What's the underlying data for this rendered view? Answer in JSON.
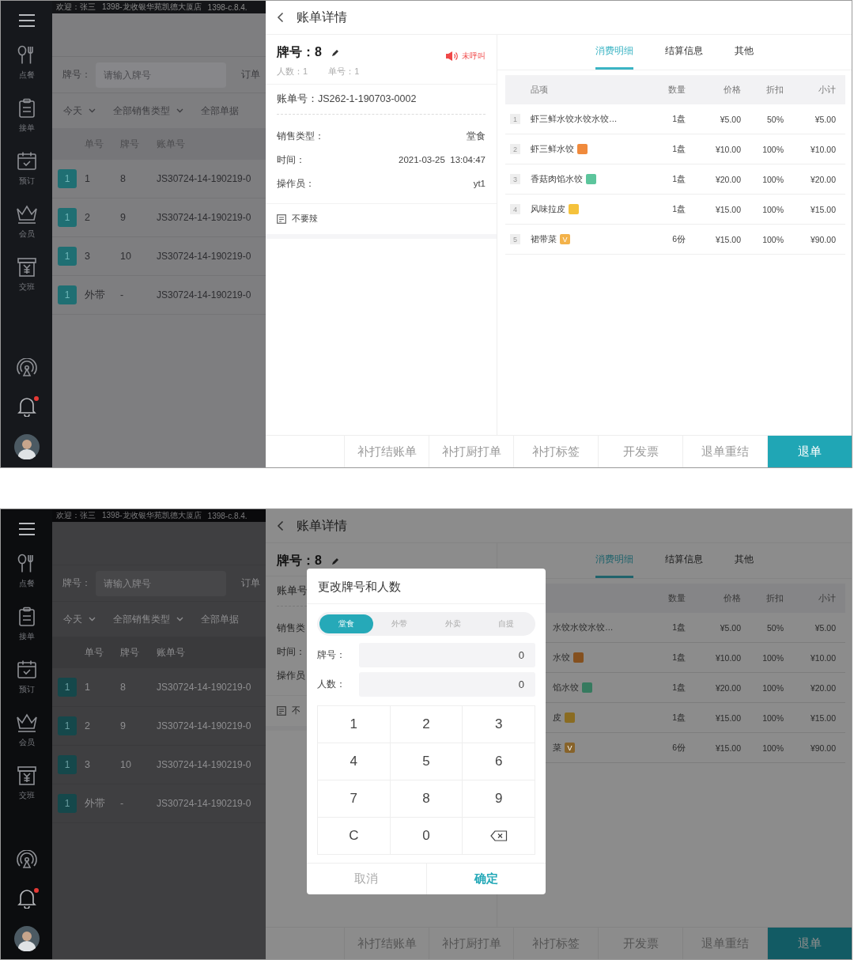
{
  "screens": [
    {
      "topbar": {
        "welcome": "欢迎：张三",
        "store": "1398-龙收银华苑凯德大厦店",
        "version": "1398-c.8.4."
      },
      "sidebar": {
        "items": [
          {
            "kind": "menu"
          },
          {
            "kind": "dine",
            "label": "点餐"
          },
          {
            "kind": "orders",
            "label": "接单"
          },
          {
            "kind": "booking",
            "label": "预订"
          },
          {
            "kind": "member",
            "label": "会员"
          },
          {
            "kind": "shift",
            "label": "交班"
          }
        ],
        "bottom": [
          {
            "kind": "broadcast"
          },
          {
            "kind": "bell",
            "unread": true
          },
          {
            "kind": "avatar"
          }
        ]
      },
      "list": {
        "filter": {
          "label": "牌号：",
          "placeholder": "请输入牌号",
          "next_label": "订单"
        },
        "dropdowns": [
          {
            "label": "今天",
            "caret": true
          },
          {
            "label": "全部销售类型",
            "caret": true
          },
          {
            "label": "全部单据",
            "caret": false
          }
        ],
        "columns": [
          "单号",
          "牌号",
          "账单号"
        ],
        "rows": [
          {
            "badge": "1",
            "order": "1",
            "plate": "8",
            "bill": "JS30724-14-190219-0"
          },
          {
            "badge": "1",
            "order": "2",
            "plate": "9",
            "bill": "JS30724-14-190219-0"
          },
          {
            "badge": "1",
            "order": "3",
            "plate": "10",
            "bill": "JS30724-14-190219-0"
          },
          {
            "badge": "1",
            "order": "外带",
            "plate": "-",
            "bill": "JS30724-14-190219-0"
          }
        ]
      },
      "detail": {
        "title": "账单详情",
        "card": {
          "plate_label": "牌号：",
          "plate": "8",
          "editable": true,
          "call": "未呼叫",
          "people": "人数：1",
          "order": "单号：1",
          "bill": "账单号：JS262-1-190703-0002",
          "info": [
            {
              "label": "销售类型：",
              "value": "堂食"
            },
            {
              "label": "时间：",
              "value": "2021-03-25  13:04:47"
            },
            {
              "label": "操作员：",
              "value": "yt1"
            }
          ],
          "note": "不要辣"
        },
        "tabs": [
          {
            "label": "消费明细",
            "selected": true
          },
          {
            "label": "结算信息",
            "selected": false
          },
          {
            "label": "其他",
            "selected": false
          }
        ],
        "table": {
          "columns": [
            {
              "kind": "item",
              "label": "品项"
            },
            {
              "kind": "qty",
              "label": "数量"
            },
            {
              "kind": "price",
              "label": "价格"
            },
            {
              "kind": "discount",
              "label": "折扣"
            },
            {
              "kind": "subtotal",
              "label": "小计"
            }
          ],
          "rows": [
            {
              "index": "1",
              "name": "虾三鲜水饺水饺水饺…",
              "qty": "1盘",
              "price": "¥5.00",
              "discount": "50%",
              "subtotal": "¥5.00"
            },
            {
              "index": "2",
              "name": "虾三鲜水饺",
              "tag": {
                "color": "#f08a3c"
              },
              "qty": "1盘",
              "price": "¥10.00",
              "discount": "100%",
              "subtotal": "¥10.00"
            },
            {
              "index": "3",
              "name": "香菇肉馅水饺",
              "tag": {
                "color": "#5cc59c"
              },
              "qty": "1盘",
              "price": "¥20.00",
              "discount": "100%",
              "subtotal": "¥20.00"
            },
            {
              "index": "4",
              "name": "风味拉皮",
              "tag": {
                "color": "#f5c23c"
              },
              "qty": "1盘",
              "price": "¥15.00",
              "discount": "100%",
              "subtotal": "¥15.00"
            },
            {
              "index": "5",
              "name": "裙带菜",
              "tag": {
                "color": "#f3b24a",
                "text": "V"
              },
              "qty": "6份",
              "price": "¥15.00",
              "discount": "100%",
              "subtotal": "¥90.00"
            }
          ]
        },
        "actions": [
          {
            "label": "补打结账单",
            "primary": false
          },
          {
            "label": "补打厨打单",
            "primary": false
          },
          {
            "label": "补打标签",
            "primary": false
          },
          {
            "label": "开发票",
            "primary": false
          },
          {
            "label": "退单重结",
            "primary": false
          },
          {
            "label": "退单",
            "primary": true
          }
        ]
      }
    },
    {
      "topbar": {
        "welcome": "欢迎：张三",
        "store": "1398-龙收银华苑凯德大厦店",
        "version": "1398-c.8.4."
      },
      "sidebar": {
        "items": [
          {
            "kind": "menu"
          },
          {
            "kind": "dine",
            "label": "点餐"
          },
          {
            "kind": "orders",
            "label": "接单"
          },
          {
            "kind": "booking",
            "label": "预订"
          },
          {
            "kind": "member",
            "label": "会员"
          },
          {
            "kind": "shift",
            "label": "交班"
          }
        ],
        "bottom": [
          {
            "kind": "broadcast"
          },
          {
            "kind": "bell",
            "unread": true
          },
          {
            "kind": "avatar"
          }
        ]
      },
      "list": {
        "filter": {
          "label": "牌号：",
          "placeholder": "请输入牌号",
          "next_label": "订单"
        },
        "dropdowns": [
          {
            "label": "今天",
            "caret": true
          },
          {
            "label": "全部销售类型",
            "caret": true
          },
          {
            "label": "全部单据",
            "caret": false
          }
        ],
        "columns": [
          "单号",
          "牌号",
          "账单号"
        ],
        "rows": [
          {
            "badge": "1",
            "order": "1",
            "plate": "8",
            "bill": "JS30724-14-190219-0"
          },
          {
            "badge": "1",
            "order": "2",
            "plate": "9",
            "bill": "JS30724-14-190219-0"
          },
          {
            "badge": "1",
            "order": "3",
            "plate": "10",
            "bill": "JS30724-14-190219-0"
          },
          {
            "badge": "1",
            "order": "外带",
            "plate": "-",
            "bill": "JS30724-14-190219-0"
          }
        ]
      },
      "detail": {
        "title": "账单详情",
        "card": {
          "plate_label": "牌号：",
          "plate": "8",
          "editable": true,
          "bill": "账单号",
          "info": [
            {
              "label": "销售类"
            },
            {
              "label": "时间："
            },
            {
              "label": "操作员"
            }
          ],
          "note": "不"
        },
        "tabs": [
          {
            "label": "消费明细",
            "selected": true
          },
          {
            "label": "结算信息",
            "selected": false
          },
          {
            "label": "其他",
            "selected": false
          }
        ],
        "table": {
          "columns": [
            {
              "kind": "qty",
              "label": "数量"
            },
            {
              "kind": "price",
              "label": "价格"
            },
            {
              "kind": "discount",
              "label": "折扣"
            },
            {
              "kind": "subtotal",
              "label": "小计"
            }
          ],
          "rows": [
            {
              "name": "水饺水饺水饺…",
              "qty": "1盘",
              "price": "¥5.00",
              "discount": "50%",
              "subtotal": "¥5.00"
            },
            {
              "name": "水饺",
              "tag": {
                "color": "#84501f"
              },
              "qty": "1盘",
              "price": "¥10.00",
              "discount": "100%",
              "subtotal": "¥10.00"
            },
            {
              "name": "馅水饺",
              "tag": {
                "color": "#367a5f"
              },
              "qty": "1盘",
              "price": "¥20.00",
              "discount": "100%",
              "subtotal": "¥20.00"
            },
            {
              "name": "皮",
              "tag": {
                "color": "#8a6c22"
              },
              "qty": "1盘",
              "price": "¥15.00",
              "discount": "100%",
              "subtotal": "¥15.00"
            },
            {
              "name": "菜",
              "tag": {
                "color": "#87632a",
                "text": "V"
              },
              "qty": "6份",
              "price": "¥15.00",
              "discount": "100%",
              "subtotal": "¥90.00"
            }
          ]
        },
        "actions": [
          {
            "label": "补打结账单",
            "primary": false
          },
          {
            "label": "补打厨打单",
            "primary": false
          },
          {
            "label": "补打标签",
            "primary": false
          },
          {
            "label": "开发票",
            "primary": false
          },
          {
            "label": "退单重结",
            "primary": false
          },
          {
            "label": "退单",
            "primary": true
          }
        ]
      },
      "dialog": {
        "title": "更改牌号和人数",
        "types": [
          {
            "label": "堂食",
            "selected": true
          },
          {
            "label": "外带",
            "selected": false
          },
          {
            "label": "外卖",
            "selected": false
          },
          {
            "label": "自提",
            "selected": false
          }
        ],
        "fields": [
          {
            "label": "牌号：",
            "value": "0"
          },
          {
            "label": "人数：",
            "value": "0"
          }
        ],
        "keys": [
          {
            "kind": "digit",
            "label": "1"
          },
          {
            "kind": "digit",
            "label": "2"
          },
          {
            "kind": "digit",
            "label": "3"
          },
          {
            "kind": "digit",
            "label": "4"
          },
          {
            "kind": "digit",
            "label": "5"
          },
          {
            "kind": "digit",
            "label": "6"
          },
          {
            "kind": "digit",
            "label": "7"
          },
          {
            "kind": "digit",
            "label": "8"
          },
          {
            "kind": "digit",
            "label": "9"
          },
          {
            "kind": "clear",
            "label": "C"
          },
          {
            "kind": "digit",
            "label": "0"
          },
          {
            "kind": "backspace"
          }
        ],
        "cancel": "取消",
        "confirm": "确定"
      }
    }
  ]
}
